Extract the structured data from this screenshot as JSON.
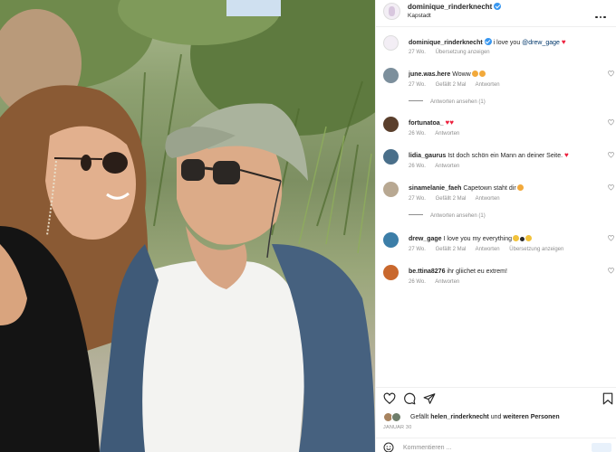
{
  "post": {
    "author": "dominique_rinderknecht",
    "location": "Kapstadt"
  },
  "caption": {
    "username": "dominique_rinderknecht",
    "text": "i love you",
    "mention": "@drew_gage",
    "time": "27 Wo.",
    "translate": "Übersetzung anzeigen"
  },
  "comments": [
    {
      "username": "june.was.here",
      "text": "Woww",
      "time": "27 Wo.",
      "likes": "Gefällt 2 Mal",
      "reply": "Antworten",
      "avatar_color": "#7c8f9c",
      "emojis": [
        "#f2a93b",
        "#f2a93b"
      ],
      "replies_label": "Antworten ansehen (1)"
    },
    {
      "username": "fortunatoa_",
      "text": "",
      "time": "26 Wo.",
      "likes": "",
      "reply": "Antworten",
      "avatar_color": "#5a3f2c",
      "hearts": "❤️❤️"
    },
    {
      "username": "lidia_gaurus",
      "text": "Ist doch schön ein Mann an deiner Seite.",
      "time": "26 Wo.",
      "likes": "",
      "reply": "Antworten",
      "avatar_color": "#4a6f8a",
      "hearts": "❤️"
    },
    {
      "username": "sinamelanie_faeh",
      "text": "Capetown staht dir",
      "time": "27 Wo.",
      "likes": "Gefällt 2 Mal",
      "reply": "Antworten",
      "avatar_color": "#b8a892",
      "emojis": [
        "#f2a93b"
      ],
      "replies_label": "Antworten ansehen (1)"
    },
    {
      "username": "drew_gage",
      "text": "I love you my everything",
      "time": "27 Wo.",
      "likes": "Gefällt 2 Mal",
      "reply": "Antworten",
      "translate": "Übersetzung anzeigen",
      "avatar_color": "#3c7ea8",
      "emojis": [
        "#f2c23b",
        "#2a2a2a",
        "#f2c23b"
      ]
    },
    {
      "username": "be.ttina8276",
      "text": "ihr gliichet eu extrem!",
      "time": "26 Wo.",
      "likes": "",
      "reply": "Antworten",
      "avatar_color": "#c9682d"
    }
  ],
  "likes": {
    "prefix": "Gefällt",
    "user": "helen_rinderknecht",
    "middle": "und",
    "others": "weiteren Personen"
  },
  "date": "JANUAR 30",
  "add_comment_placeholder": "Kommentieren ...",
  "icons": [
    "more-icon",
    "heart-icon",
    "comment-icon",
    "share-icon",
    "bookmark-icon",
    "smile-icon",
    "verified-icon"
  ],
  "colors": {
    "link": "#00376b",
    "verified": "#3897f0",
    "muted": "#8e8e8e",
    "heart": "#ed1f3c"
  }
}
